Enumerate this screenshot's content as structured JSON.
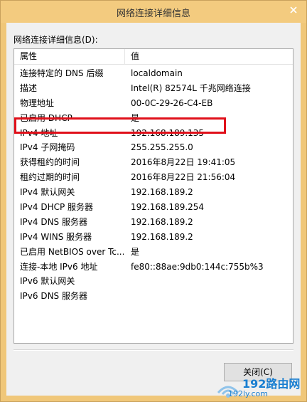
{
  "window": {
    "title": "网络连接详细信息"
  },
  "group_label": "网络连接详细信息(D):",
  "columns": {
    "property": "属性",
    "value": "值"
  },
  "rows": [
    {
      "property": "连接特定的 DNS 后缀",
      "value": "localdomain"
    },
    {
      "property": "描述",
      "value": "Intel(R) 82574L 千兆网络连接"
    },
    {
      "property": "物理地址",
      "value": "00-0C-29-26-C4-EB"
    },
    {
      "property": "已启用 DHCP",
      "value": "是"
    },
    {
      "property": "IPv4 地址",
      "value": "192.168.189.135"
    },
    {
      "property": "IPv4 子网掩码",
      "value": "255.255.255.0"
    },
    {
      "property": "获得租约的时间",
      "value": "2016年8月22日 19:41:05"
    },
    {
      "property": "租约过期的时间",
      "value": "2016年8月22日 21:56:04"
    },
    {
      "property": "IPv4 默认网关",
      "value": "192.168.189.2"
    },
    {
      "property": "IPv4 DHCP 服务器",
      "value": "192.168.189.254"
    },
    {
      "property": "IPv4 DNS 服务器",
      "value": "192.168.189.2"
    },
    {
      "property": "IPv4 WINS 服务器",
      "value": "192.168.189.2"
    },
    {
      "property": "已启用 NetBIOS over Tc...",
      "value": "是"
    },
    {
      "property": "连接-本地 IPv6 地址",
      "value": "fe80::88ae:9db0:144c:755b%3"
    },
    {
      "property": "IPv6 默认网关",
      "value": ""
    },
    {
      "property": "IPv6 DNS 服务器",
      "value": ""
    }
  ],
  "close_button_label": "关闭(C)",
  "watermark": {
    "logo_text": "192路由网",
    "url_text": "192ly.com"
  },
  "colors": {
    "highlight": "#e0101a",
    "titlebar": "#f3cb7f"
  }
}
